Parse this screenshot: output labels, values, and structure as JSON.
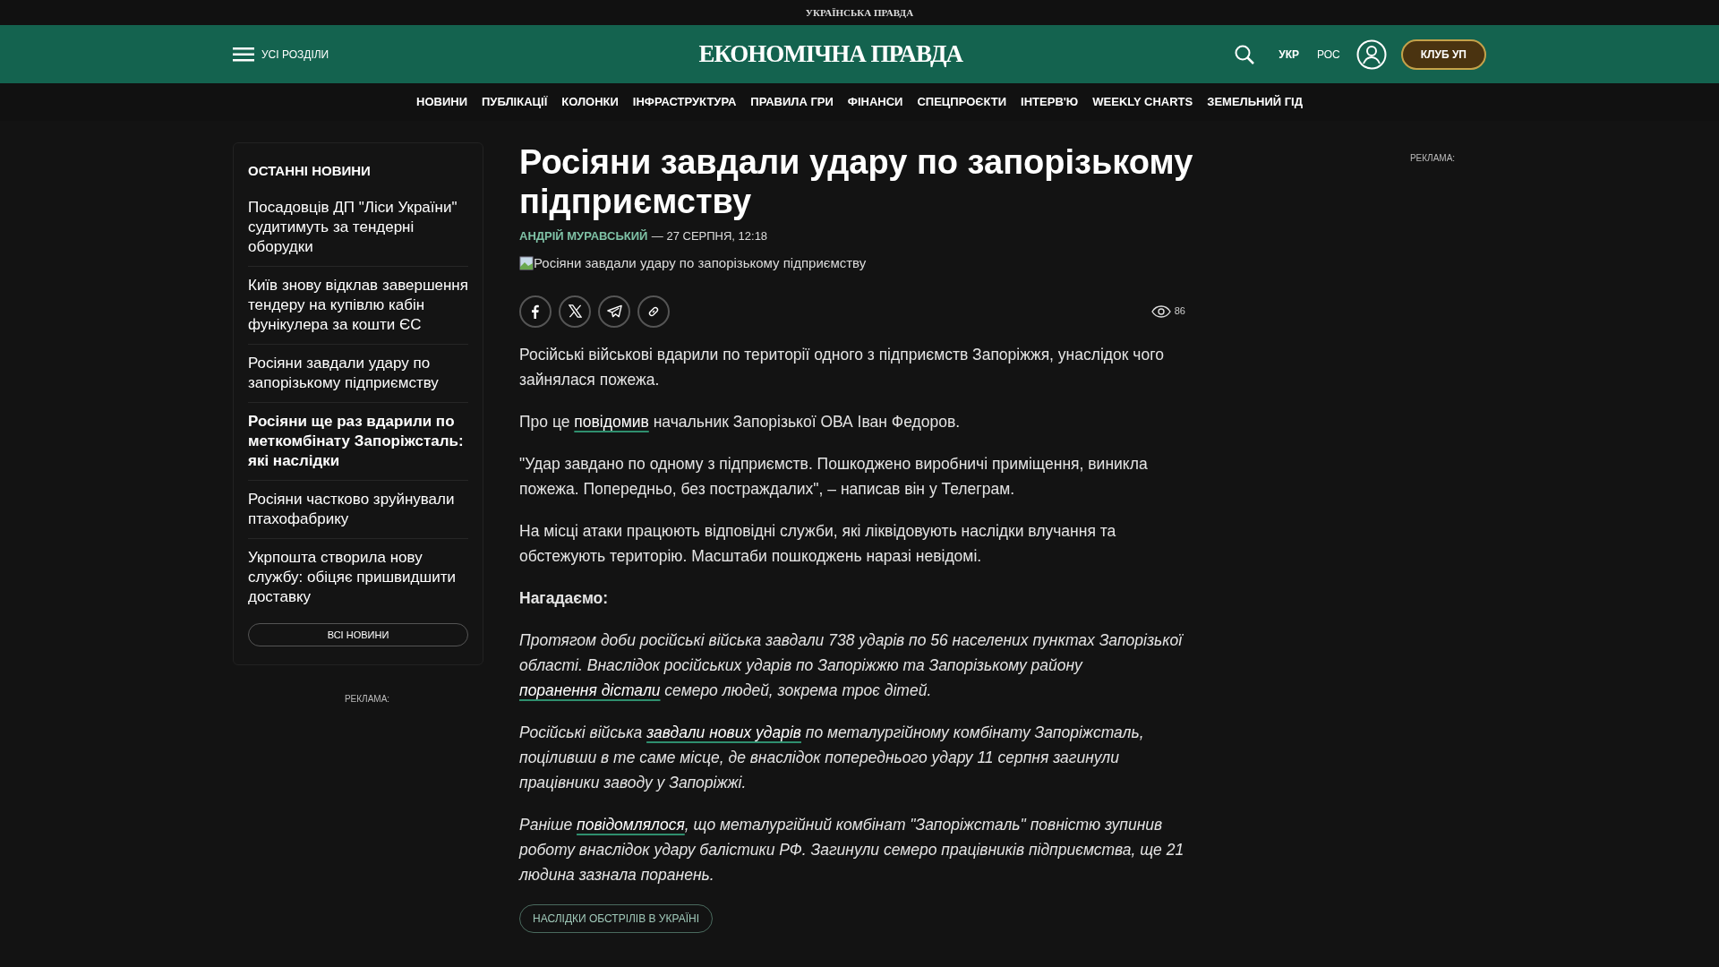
{
  "top_bar": {
    "site_name": "УКРАЇНСЬКА ПРАВДА"
  },
  "header": {
    "menu_label": "УСІ РОЗДІЛИ",
    "logo": "ЕКОНОМІЧНА ПРАВДА",
    "languages": [
      {
        "label": "УКР",
        "selected": true
      },
      {
        "label": "РОС",
        "selected": false
      }
    ],
    "club_button": "КЛУБ УП"
  },
  "nav": [
    "НОВИНИ",
    "ПУБЛІКАЦІЇ",
    "КОЛОНКИ",
    "ІНФРАСТРУКТУРА",
    "ПРАВИЛА ГРИ",
    "ФІНАНСИ",
    "СПЕЦПРОЄКТИ",
    "ІНТЕРВ'Ю",
    "WEEKLY CHARTS",
    "ЗЕМЕЛЬНИЙ ГІД"
  ],
  "sidebar": {
    "title": "ОСТАННІ НОВИНИ",
    "items": [
      {
        "text": "Посадовців ДП \"Ліси України\" судитимуть за тендерні оборудки",
        "bold": false
      },
      {
        "text": "Київ знову відклав завершення тендеру на купівлю кабін фунікулера за кошти ЄС",
        "bold": false
      },
      {
        "text": "Росіяни завдали удару по запорізькому підприємству",
        "bold": false
      },
      {
        "text": "Росіяни ще раз вдарили по меткомбінату Запоріжсталь: які наслідки",
        "bold": true
      },
      {
        "text": "Росіяни частково зруйнували птахофабрику",
        "bold": false
      },
      {
        "text": "Укрпошта створила нову службу: обіцяє пришвидшити доставку",
        "bold": false
      }
    ],
    "all_button": "ВСІ НОВИНИ",
    "ad_label": "РЕКЛАМА:"
  },
  "article": {
    "title": "Росіяни завдали удару по запорізькому підприємству",
    "author": "АНДРІЙ МУРАВСЬКИЙ",
    "date": "— 27 СЕРПНЯ, 12:18",
    "image_alt": "Росіяни завдали удару по запорізькому підприємству",
    "views": "86",
    "paragraphs": [
      {
        "kind": "text",
        "parts": [
          {
            "text": "Російські військові вдарили по території одного з підприємств Запоріжжя, унаслідок чого зайнялася пожежа.",
            "link": false
          }
        ]
      },
      {
        "kind": "text",
        "parts": [
          {
            "text": "Про це ",
            "link": false
          },
          {
            "text": "повідомив",
            "link": true
          },
          {
            "text": " начальник Запорізької ОВА Іван Федоров.",
            "link": false
          }
        ]
      },
      {
        "kind": "text",
        "parts": [
          {
            "text": "\"Удар завдано по одному з підприємств. Пошкоджено виробничі приміщення, виникла пожежа. Попередньо, без постраждалих\", – написав він у Телеграм.",
            "link": false
          }
        ]
      },
      {
        "kind": "text",
        "parts": [
          {
            "text": "На місці атаки працюють відповідні служби, які ліквідовують наслідки влучання та обстежують територію. Масштаби пошкоджень наразі невідомі.",
            "link": false
          }
        ]
      },
      {
        "kind": "heading",
        "parts": [
          {
            "text": "Нагадаємо:",
            "link": false
          }
        ]
      },
      {
        "kind": "italic",
        "parts": [
          {
            "text": "Протягом доби російські війська завдали 738 ударів по 56 населених пунктах Запорізької області. Внаслідок російських ударів по Запоріжжю та Запорізькому району ",
            "link": false
          },
          {
            "text": "поранення дістали",
            "link": true
          },
          {
            "text": " семеро людей, зокрема троє дітей.",
            "link": false
          }
        ]
      },
      {
        "kind": "italic",
        "parts": [
          {
            "text": "Російські війська ",
            "link": false
          },
          {
            "text": "завдали нових ударів",
            "link": true
          },
          {
            "text": " по металургійному комбінату Запоріжсталь, поціливши в те саме місце, де внаслідок попереднього удару 11 серпня загинули працівники заводу у Запоріжжі.",
            "link": false
          }
        ]
      },
      {
        "kind": "italic",
        "parts": [
          {
            "text": "Раніше ",
            "link": false
          },
          {
            "text": "повідомлялося",
            "link": true
          },
          {
            "text": ", що металургійний комбінат \"Запоріжсталь\" повністю зупинив роботу внаслідок удару балістики РФ. Загинули семеро працівників підприємства, ще 21 людина зазнала поранень.",
            "link": false
          }
        ]
      }
    ],
    "tags": [
      "НАСЛІДКИ ОБСТРІЛІВ В УКРАЇНІ"
    ]
  },
  "right_ad": {
    "label": "РЕКЛАМА:"
  }
}
